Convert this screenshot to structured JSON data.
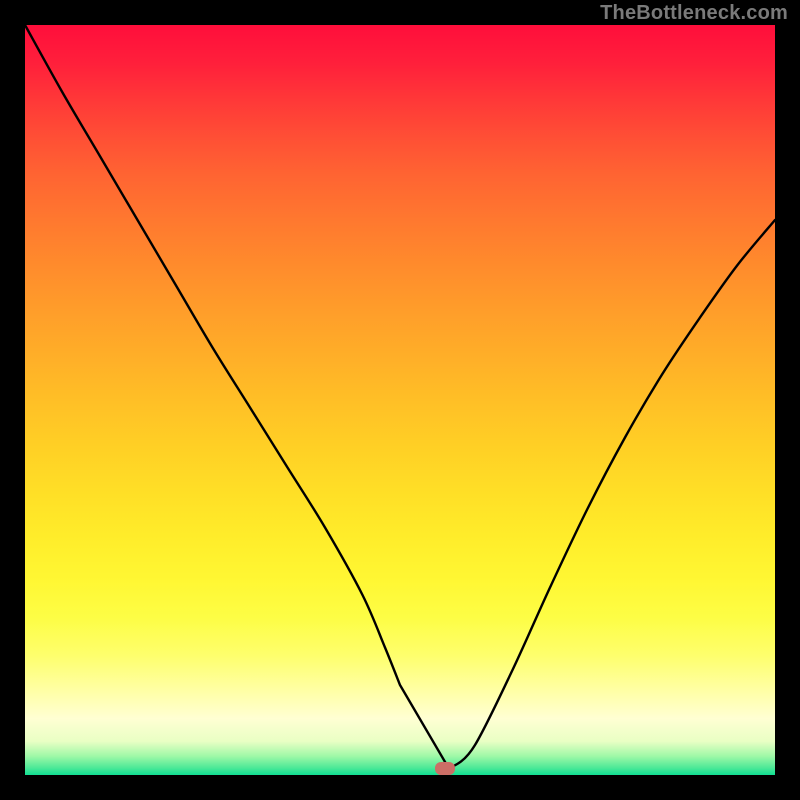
{
  "watermark": "TheBottleneck.com",
  "colors": {
    "gradient_top": "#ff0e3b",
    "gradient_mid": "#ffec2a",
    "gradient_bottom": "#11df93",
    "curve": "#000000",
    "marker": "#cc6e66",
    "frame": "#000000"
  },
  "chart_data": {
    "type": "line",
    "title": "",
    "xlabel": "",
    "ylabel": "",
    "xlim": [
      0,
      100
    ],
    "ylim": [
      0,
      100
    ],
    "series": [
      {
        "name": "bottleneck-curve",
        "x": [
          0,
          5,
          10,
          15,
          20,
          25,
          30,
          35,
          40,
          45,
          48,
          50,
          52.5,
          55,
          56,
          57,
          60,
          65,
          70,
          75,
          80,
          85,
          90,
          95,
          100
        ],
        "y": [
          100,
          91,
          82.5,
          74,
          65.5,
          57,
          49,
          41,
          33,
          24,
          17,
          12,
          6,
          1.5,
          0.8,
          0.8,
          4,
          14,
          25,
          35.5,
          45,
          53.5,
          61,
          68,
          74
        ]
      }
    ],
    "flat_segment": {
      "x_start": 50,
      "x_end": 56.5,
      "y": 0.9
    },
    "marker": {
      "x": 56,
      "y": 0.9
    },
    "annotations": []
  }
}
